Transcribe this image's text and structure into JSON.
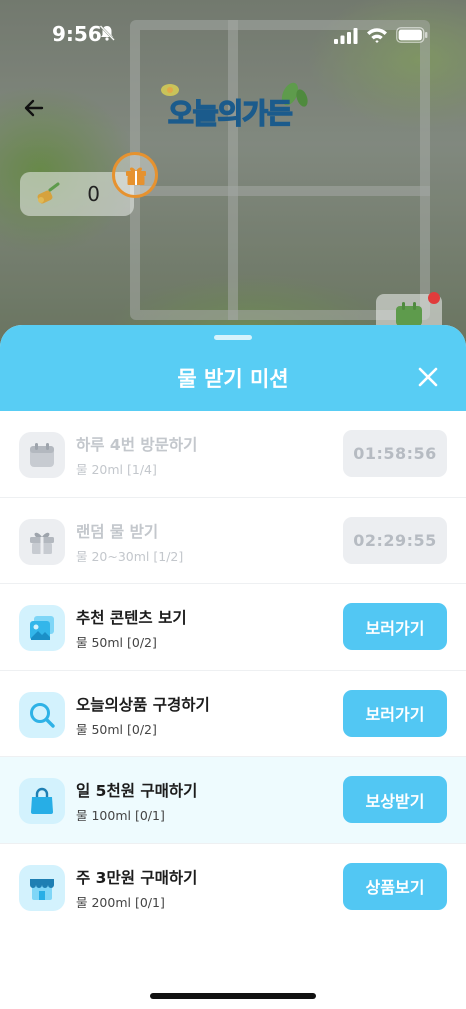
{
  "status_bar": {
    "time": "9:56"
  },
  "background": {
    "logo_text": "오늘의가든",
    "coin_count": "0"
  },
  "sheet": {
    "title": "물 받기 미션",
    "missions": [
      {
        "title": "하루 4번 방문하기",
        "subtitle": "물 20ml [1/4]",
        "button": "01:58:56",
        "state": "disabled",
        "icon": "calendar-icon"
      },
      {
        "title": "랜덤 물 받기",
        "subtitle": "물 20~30ml [1/2]",
        "button": "02:29:55",
        "state": "disabled",
        "icon": "gift-icon"
      },
      {
        "title": "추천 콘텐츠 보기",
        "subtitle": "물 50ml [0/2]",
        "button": "보러가기",
        "state": "active",
        "icon": "image-icon"
      },
      {
        "title": "오늘의상품 구경하기",
        "subtitle": "물 50ml [0/2]",
        "button": "보러가기",
        "state": "active",
        "icon": "search-icon"
      },
      {
        "title": "일 5천원 구매하기",
        "subtitle": "물 100ml [0/1]",
        "button": "보상받기",
        "state": "active",
        "icon": "shopping-bag-icon"
      },
      {
        "title": "주 3만원 구매하기",
        "subtitle": "물 200ml [0/1]",
        "button": "상품보기",
        "state": "active",
        "icon": "store-icon"
      }
    ]
  },
  "colors": {
    "accent": "#58cdf4",
    "button": "#52c7f3",
    "disabled_button": "#eceef1",
    "highlight_row": "#eefbfe"
  }
}
